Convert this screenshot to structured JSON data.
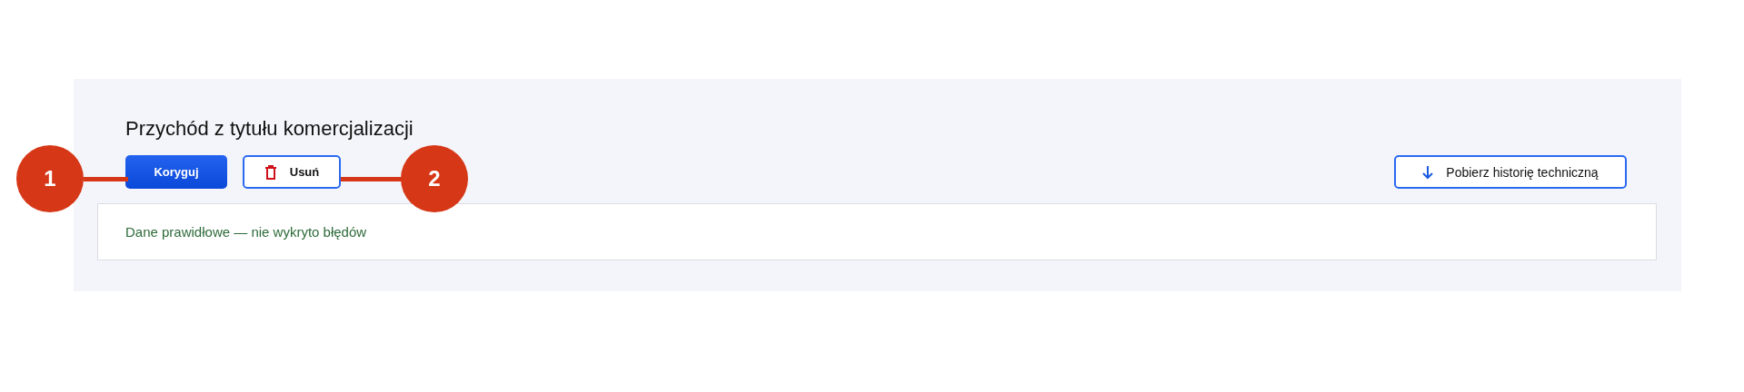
{
  "title": "Przychód z tytułu komercjalizacji",
  "actions": [
    {
      "label": "Koryguj",
      "kind": "primary"
    },
    {
      "label": "Usuń",
      "kind": "delete"
    }
  ],
  "extra_action": {
    "label": "Pobierz historię techniczną",
    "kind": "download"
  },
  "message": {
    "text": "Dane prawidłowe — nie wykryto błędów",
    "kind": "success"
  },
  "callouts": [
    {
      "label": "1"
    },
    {
      "label": "2"
    }
  ]
}
